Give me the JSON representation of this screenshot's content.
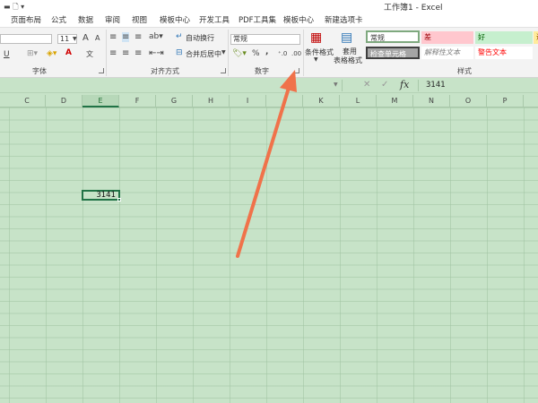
{
  "window": {
    "title": "工作簿1 - Excel"
  },
  "tabs": [
    "页面布局",
    "公式",
    "数据",
    "审阅",
    "视图",
    "模板中心",
    "开发工具",
    "PDF工具集",
    "模板中心",
    "新建选项卡"
  ],
  "ribbon": {
    "font_size": "11",
    "font_grow": "A",
    "font_shrink": "A",
    "underline": "U",
    "font_color_letter": "A",
    "wen": "文",
    "wrap_text": "自动换行",
    "merge_center": "合并后居中",
    "number_format": "常规",
    "percent": "%",
    "comma": ",",
    "inc_decimal": "⁺.0",
    "dec_decimal": ".00",
    "conditional_format_line1": "条件格式",
    "table_format_line1": "套用",
    "table_format_line2": "表格格式",
    "group_font": "字体",
    "group_alignment": "对齐方式",
    "group_number": "数字",
    "group_styles": "样式",
    "styles": {
      "normal": "常规",
      "bad": "差",
      "good": "好",
      "neutral": "适",
      "check_cell": "检查单元格",
      "explanatory": "解释性文本",
      "warning": "警告文本"
    }
  },
  "formula_bar": {
    "fx": "fx",
    "cancel": "✕",
    "enter": "✓",
    "value": "3141"
  },
  "columns": [
    "C",
    "D",
    "E",
    "F",
    "G",
    "H",
    "I",
    "J",
    "K",
    "L",
    "M",
    "N",
    "O",
    "P"
  ],
  "active_column": "E",
  "cell": {
    "value": "3141"
  },
  "colors": {
    "grid_bg": "#c7e3c8",
    "excel_green": "#217346",
    "arrow": "#f0724a"
  }
}
